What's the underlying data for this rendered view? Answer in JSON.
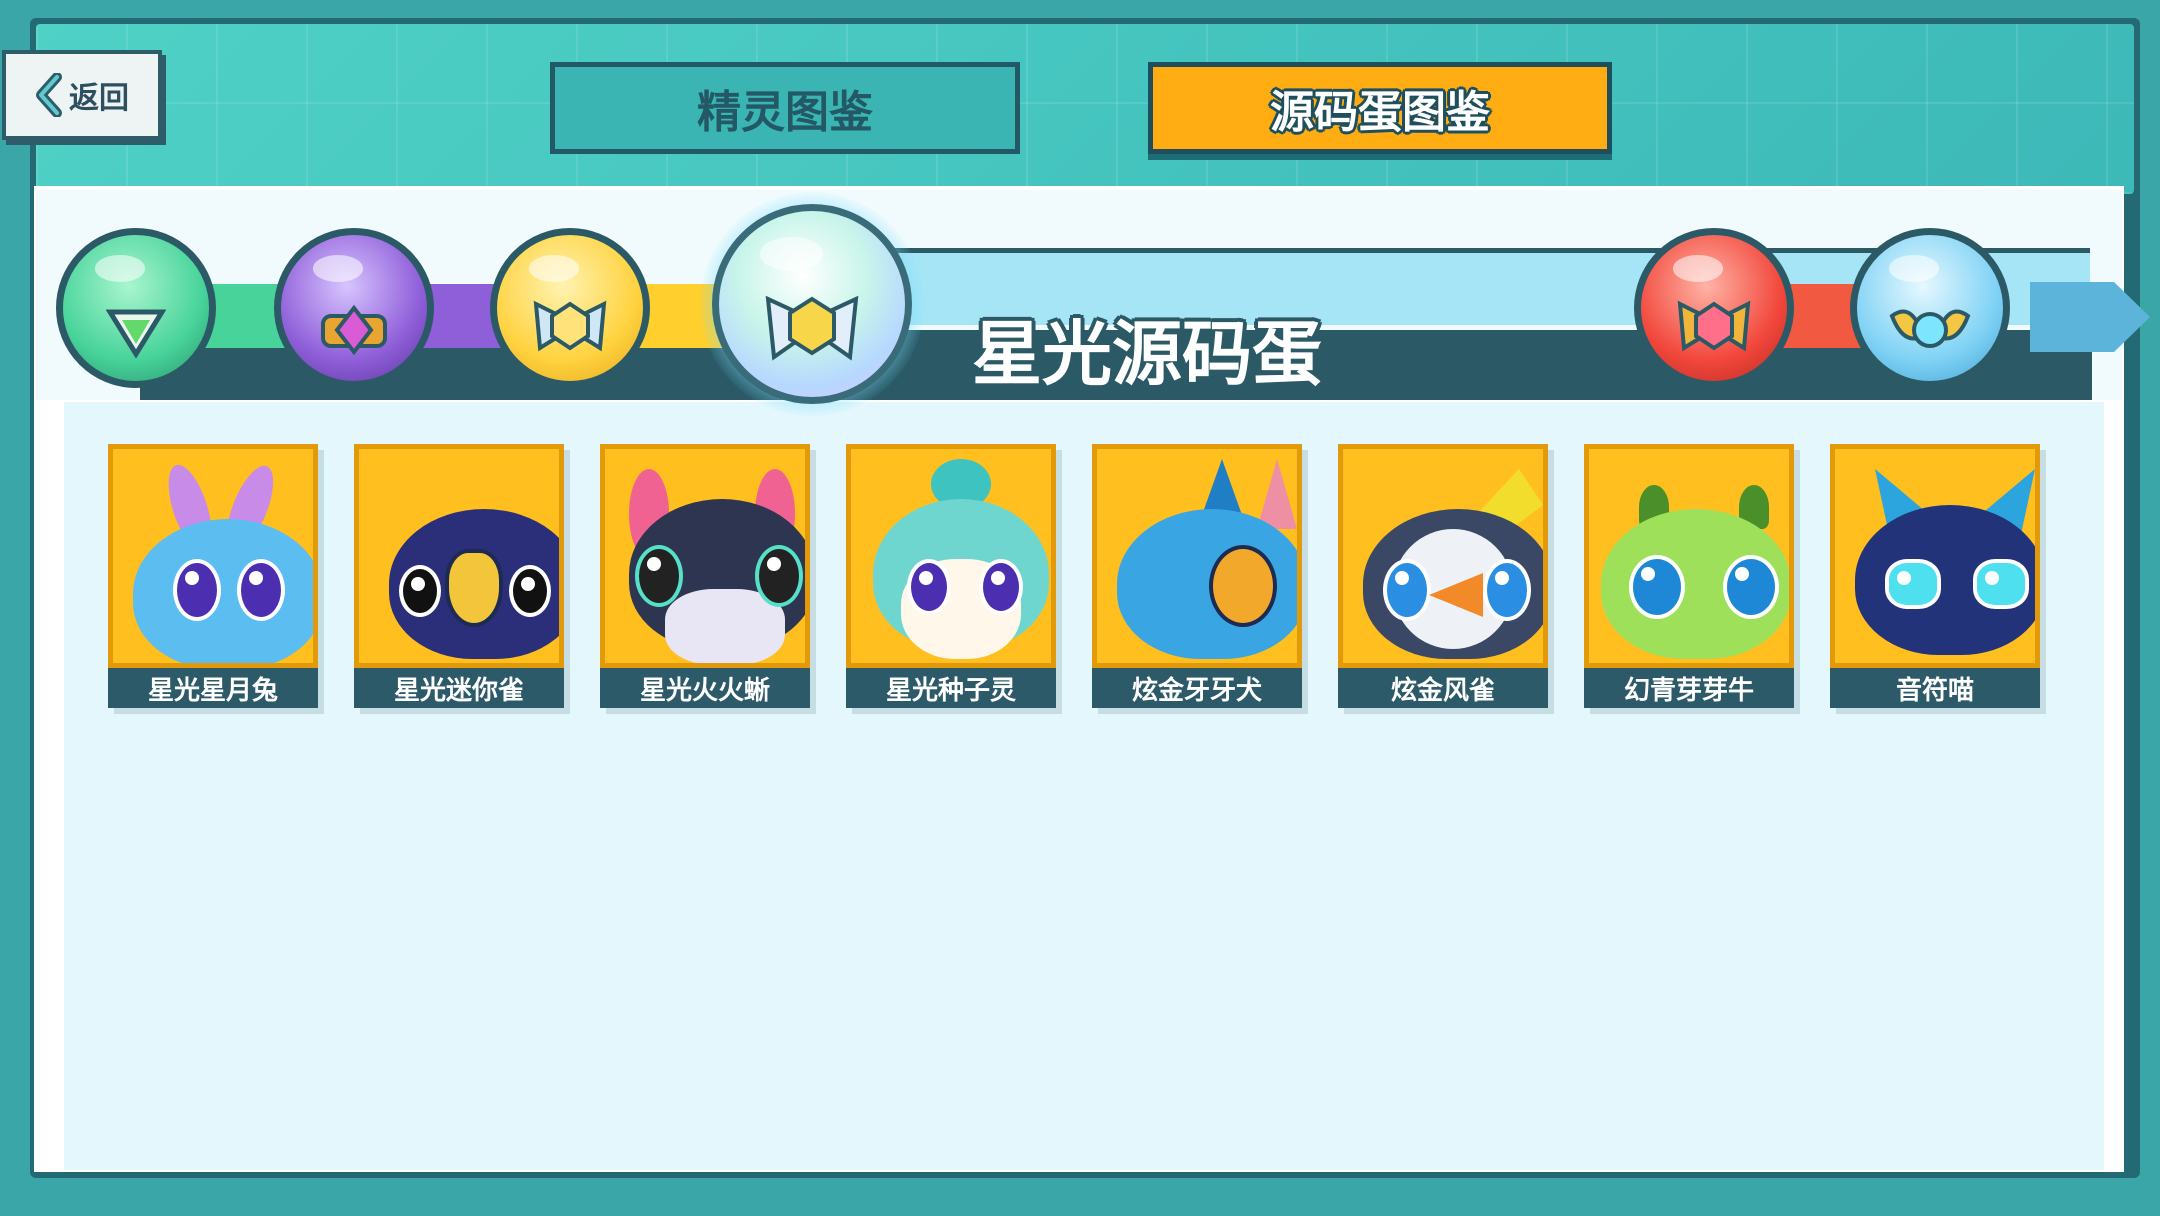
{
  "header": {
    "back_label": "返回",
    "tabs": [
      {
        "label": "精灵图鉴",
        "active": false
      },
      {
        "label": "源码蛋图鉴",
        "active": true
      }
    ]
  },
  "egg_selector": {
    "selected_title": "星光源码蛋",
    "eggs": [
      {
        "icon": "green-egg-icon",
        "color": "#47d39a"
      },
      {
        "icon": "purple-egg-icon",
        "color": "#8f5ed9"
      },
      {
        "icon": "gold-egg-icon",
        "color": "#ffd23f"
      },
      {
        "icon": "rainbow-egg-icon",
        "color": "#bff0e8",
        "selected": true
      },
      {
        "icon": "red-egg-icon",
        "color": "#f2473c"
      },
      {
        "icon": "blue-egg-icon",
        "color": "#7fd2f5"
      }
    ]
  },
  "sprites": [
    {
      "name": "星光星月兔",
      "color": "#5bbdf0"
    },
    {
      "name": "星光迷你雀",
      "color": "#2b2f7a"
    },
    {
      "name": "星光火火蜥",
      "color": "#2d3550"
    },
    {
      "name": "星光种子灵",
      "color": "#6ed6cf"
    },
    {
      "name": "炫金牙牙犬",
      "color": "#3aa5e3"
    },
    {
      "name": "炫金风雀",
      "color": "#3a4866"
    },
    {
      "name": "幻青芽芽牛",
      "color": "#9ee05a"
    },
    {
      "name": "音符喵",
      "color": "#23337a"
    }
  ]
}
